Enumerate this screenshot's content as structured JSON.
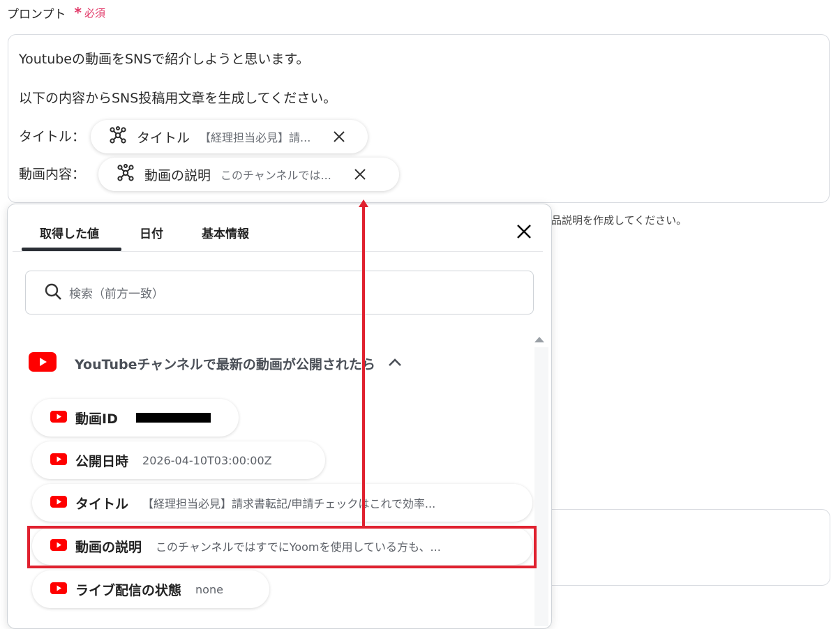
{
  "field": {
    "label": "プロンプト",
    "required_mark": "*",
    "required_text": "必須"
  },
  "prompt": {
    "line1": "Youtubeの動画をSNSで紹介しようと思います。",
    "line2": "以下の内容からSNS投稿用文章を生成してください。",
    "title_label": "タイトル：",
    "desc_label": "動画内容：",
    "chips": [
      {
        "name": "タイトル",
        "value": "【経理担当必見】請..."
      },
      {
        "name": "動画の説明",
        "value": "このチャンネルでは..."
      }
    ]
  },
  "background": {
    "note": "品説明を作成してください。"
  },
  "panel": {
    "tabs": [
      "取得した値",
      "日付",
      "基本情報"
    ],
    "active_tab": "取得した値",
    "search_placeholder": "検索（前方一致）",
    "section_title": "YouTubeチャンネルで最新の動画が公開されたら",
    "items": [
      {
        "name": "動画ID",
        "value": ""
      },
      {
        "name": "公開日時",
        "value": "2026-04-10T03:00:00Z"
      },
      {
        "name": "タイトル",
        "value": "【経理担当必見】請求書転記/申請チェックはこれで効率..."
      },
      {
        "name": "動画の説明",
        "value": "このチャンネルではすでにYoomを使用している方も、..."
      },
      {
        "name": "ライブ配信の状態",
        "value": "none"
      }
    ]
  },
  "colors": {
    "required": "#e23b6a",
    "youtube": "#ff0000",
    "annotation": "#e0212f"
  }
}
